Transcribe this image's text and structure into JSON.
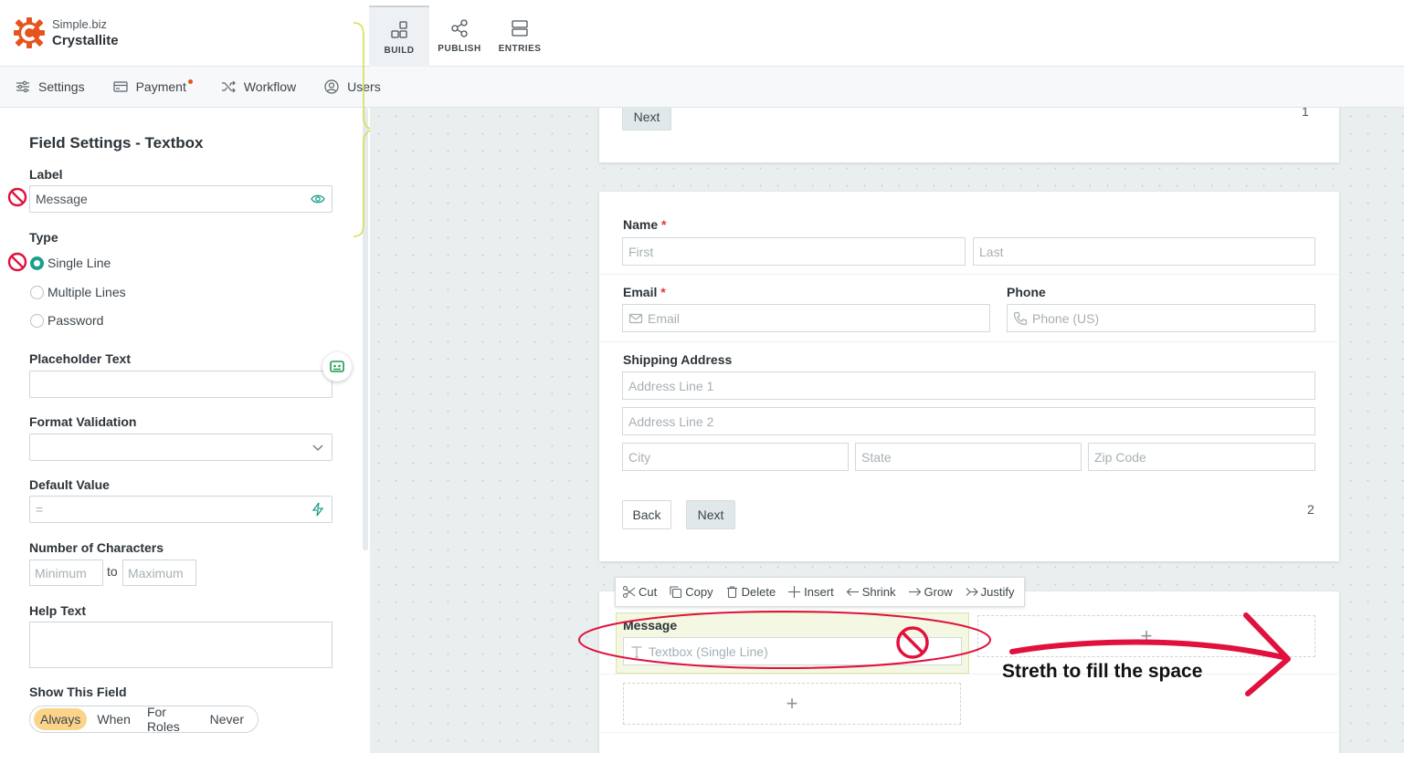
{
  "app": {
    "org": "Simple.biz",
    "name": "Crystallite"
  },
  "nav_tabs": [
    {
      "label": "BUILD",
      "icon": "build-icon",
      "active": true
    },
    {
      "label": "PUBLISH",
      "icon": "publish-icon",
      "active": false
    },
    {
      "label": "ENTRIES",
      "icon": "entries-icon",
      "active": false
    }
  ],
  "toolbar": [
    {
      "label": "Settings",
      "icon": "settings-sliders-icon"
    },
    {
      "label": "Payment",
      "icon": "payment-card-icon",
      "badge_dot": true
    },
    {
      "label": "Workflow",
      "icon": "workflow-shuffle-icon"
    },
    {
      "label": "Users",
      "icon": "users-icon"
    }
  ],
  "settings_panel": {
    "title": "Field Settings - Textbox",
    "label_heading": "Label",
    "label_value": "Message",
    "type_heading": "Type",
    "type_options": [
      "Single Line",
      "Multiple Lines",
      "Password"
    ],
    "type_selected": "Single Line",
    "placeholder_heading": "Placeholder Text",
    "placeholder_value": "",
    "format_heading": "Format Validation",
    "format_value": "",
    "default_heading": "Default Value",
    "default_value": "=",
    "chars_heading": "Number of Characters",
    "chars_min_placeholder": "Minimum",
    "chars_to": "to",
    "chars_max_placeholder": "Maximum",
    "help_heading": "Help Text",
    "help_value": "",
    "show_heading": "Show This Field",
    "show_options": [
      "Always",
      "When",
      "For Roles",
      "Never"
    ],
    "show_selected": "Always"
  },
  "form": {
    "page1": {
      "next_label": "Next",
      "page_number": "1"
    },
    "page2": {
      "name_label": "Name",
      "name_first_placeholder": "First",
      "name_last_placeholder": "Last",
      "email_label": "Email",
      "email_placeholder": "Email",
      "phone_label": "Phone",
      "phone_placeholder": "Phone (US)",
      "address_label": "Shipping Address",
      "address_line1_placeholder": "Address Line 1",
      "address_line2_placeholder": "Address Line 2",
      "city_placeholder": "City",
      "state_placeholder": "State",
      "zip_placeholder": "Zip Code",
      "back_label": "Back",
      "next_label": "Next",
      "page_number": "2"
    },
    "field_toolbar": [
      {
        "label": "Cut",
        "icon": "scissors-icon"
      },
      {
        "label": "Copy",
        "icon": "copy-icon"
      },
      {
        "label": "Delete",
        "icon": "trash-icon"
      },
      {
        "label": "Insert",
        "icon": "plus-icon"
      },
      {
        "label": "Shrink",
        "icon": "arrow-left-icon"
      },
      {
        "label": "Grow",
        "icon": "arrow-right-icon"
      },
      {
        "label": "Justify",
        "icon": "double-chevron-right-icon"
      }
    ],
    "message_field": {
      "label": "Message",
      "placeholder": "Textbox (Single Line)"
    },
    "add_symbol": "+"
  },
  "annotation": {
    "text": "Streth to fill the space",
    "color": "#e0113c"
  },
  "colors": {
    "accent": "#1c9e8c",
    "brand": "#e5541c",
    "required": "#e0383b",
    "highlight": "#fbd48a"
  }
}
